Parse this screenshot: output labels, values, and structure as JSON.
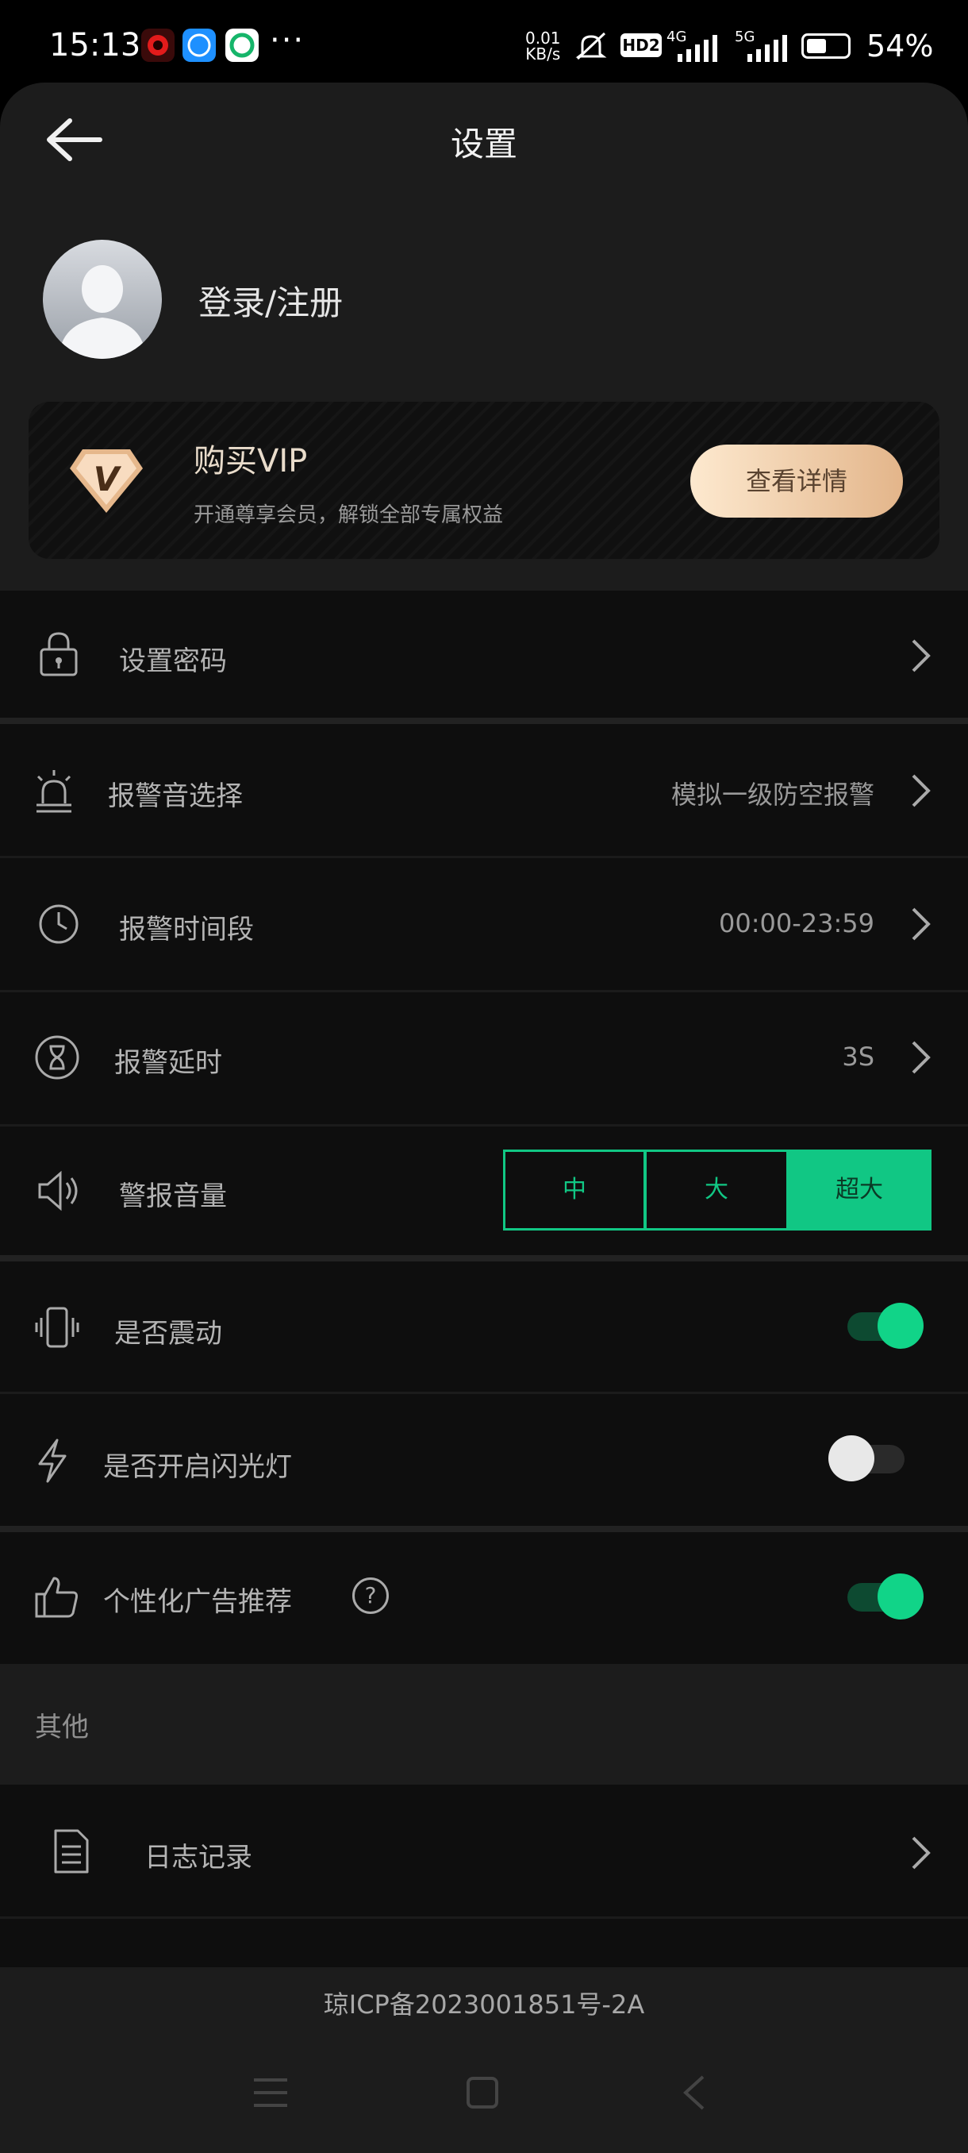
{
  "status_bar": {
    "time": "15:13",
    "dots": "···",
    "net_speed_value": "0.01",
    "net_speed_unit": "KB/s",
    "hd_badge": "HD2",
    "net_4g": "4G",
    "net_5g": "5G",
    "battery_pct": "54%"
  },
  "header": {
    "title": "设置"
  },
  "profile": {
    "login_label": "登录/注册"
  },
  "vip": {
    "title": "购买VIP",
    "subtitle": "开通尊享会员，解锁全部专属权益",
    "button_label": "查看详情",
    "badge_letter": "V"
  },
  "settings": {
    "password": {
      "label": "设置密码"
    },
    "alarm_sound": {
      "label": "报警音选择",
      "value": "模拟一级防空报警"
    },
    "alarm_period": {
      "label": "报警时间段",
      "value": "00:00-23:59"
    },
    "alarm_delay": {
      "label": "报警延时",
      "value": "3S"
    },
    "alarm_volume": {
      "label": "警报音量",
      "options": [
        "中",
        "大",
        "超大"
      ],
      "selected": "超大"
    },
    "vibrate": {
      "label": "是否震动",
      "on": true
    },
    "flashlight": {
      "label": "是否开启闪光灯",
      "on": false
    },
    "personal_ads": {
      "label": "个性化广告推荐",
      "on": true,
      "help": "?"
    }
  },
  "other_section": {
    "title": "其他"
  },
  "log": {
    "label": "日志记录"
  },
  "footer": {
    "icp": "琼ICP备2023001851号-2A"
  },
  "colors": {
    "accent": "#11c784",
    "vip_gold": "#e3b58a"
  }
}
